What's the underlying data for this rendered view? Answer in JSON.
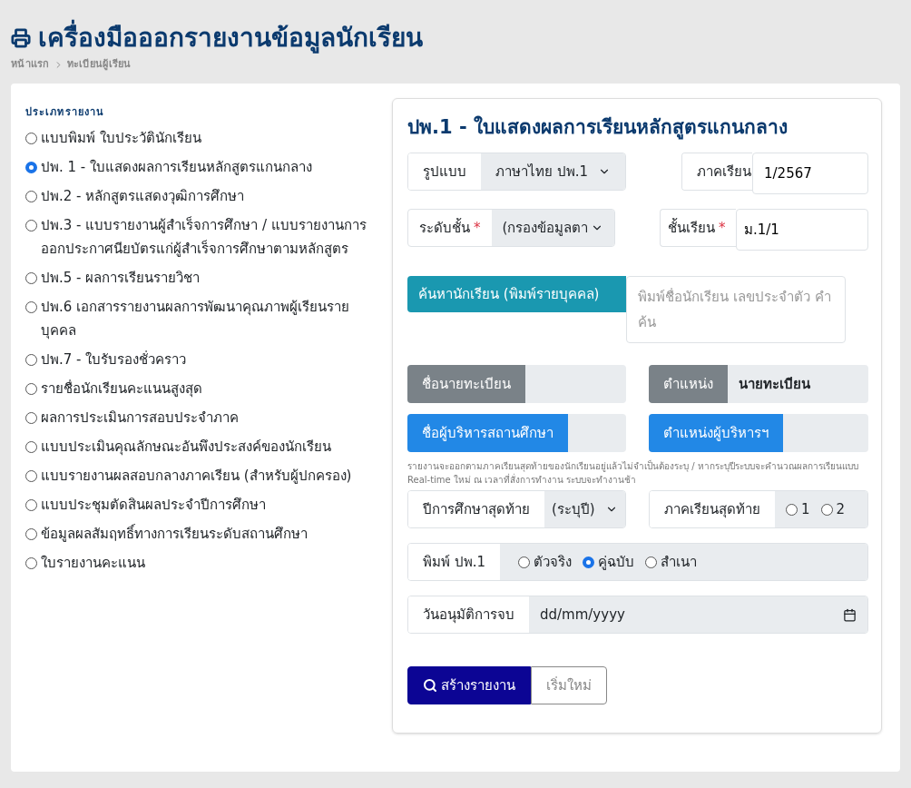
{
  "header": {
    "title": "เครื่องมือออกรายงานข้อมูลนักเรียน",
    "breadcrumb": [
      "หน้าแรก",
      "ทะเบียนผู้เรียน"
    ]
  },
  "report_types": {
    "label": "ประเภทรายงาน",
    "options": [
      {
        "label": "แบบพิมพ์ ใบประวัตินักเรียน",
        "selected": false
      },
      {
        "label": "ปพ. 1 - ใบแสดงผลการเรียนหลักสูตรแกนกลาง",
        "selected": true
      },
      {
        "label": "ปพ.2 - หลักสูตรแสดงวุฒิการศึกษา",
        "selected": false
      },
      {
        "label": "ปพ.3 - แบบรายงานผู้สำเร็จการศึกษา / แบบรายงานการออกประกาศนียบัตรแก่ผู้สำเร็จการศึกษาตามหลักสูตร",
        "selected": false
      },
      {
        "label": "ปพ.5 - ผลการเรียนรายวิชา",
        "selected": false
      },
      {
        "label": "ปพ.6 เอกสารรายงานผลการพัฒนาคุณภาพผู้เรียนรายบุคคล",
        "selected": false
      },
      {
        "label": "ปพ.7 - ใบรับรองชั่วคราว",
        "selected": false
      },
      {
        "label": "รายชื่อนักเรียนคะแนนสูงสุด",
        "selected": false
      },
      {
        "label": "ผลการประเมินการสอบประจำภาค",
        "selected": false
      },
      {
        "label": "แบบประเมินคุณลักษณะอันพึงประสงค์ของนักเรียน",
        "selected": false
      },
      {
        "label": "แบบรายงานผลสอบกลางภาคเรียน (สำหรับผู้ปกครอง)",
        "selected": false
      },
      {
        "label": "แบบประชุมตัดสินผลประจำปีการศึกษา",
        "selected": false
      },
      {
        "label": "ข้อมูลผลสัมฤทธิ์ทางการเรียนระดับสถานศึกษา",
        "selected": false
      },
      {
        "label": "ใบรายงานคะแนน",
        "selected": false
      }
    ]
  },
  "form": {
    "title": "ปพ.1 - ใบแสดงผลการเรียนหลักสูตรแกนกลาง",
    "format": {
      "label": "รูปแบบ",
      "value": "ภาษาไทย ปพ.1"
    },
    "semester": {
      "label": "ภาคเรียน",
      "value": "1/2567"
    },
    "level": {
      "label": "ระดับชั้น",
      "required_mark": "*",
      "value": "(กรองข้อมูลตา"
    },
    "classroom": {
      "label": "ชั้นเรียน",
      "required_mark": "*",
      "value": "ม.1/1"
    },
    "search": {
      "button": "ค้นหานักเรียน (พิมพ์รายบุคคล)",
      "placeholder": "พิมพ์ชื่อนักเรียน เลขประจำตัว คำค้น"
    },
    "registrar_name": {
      "label": "ชื่อนายทะเบียน"
    },
    "registrar_position": {
      "label": "ตำแหน่ง",
      "value": "นายทะเบียน"
    },
    "director_name": {
      "label": "ชื่อผู้บริหารสถานศึกษา"
    },
    "director_position": {
      "label": "ตำแหน่งผู้บริหารฯ"
    },
    "note": "รายงานจะออกตามภาคเรียนสุดท้ายของนักเรียนอยู่แล้วไม่จำเป็นต้องระบุ / หากระบุปีระบบจะคำนวณผลการเรียนแบบ Real-time ใหม่ ณ เวลาที่สั่งการทำงาน ระบบจะทำงานช้า",
    "last_year": {
      "label": "ปีการศึกษาสุดท้าย",
      "value": "(ระบุปี)"
    },
    "last_semester": {
      "label": "ภาคเรียนสุดท้าย",
      "options": [
        {
          "label": "1",
          "selected": false
        },
        {
          "label": "2",
          "selected": false
        }
      ]
    },
    "print_type": {
      "label": "พิมพ์ ปพ.1",
      "options": [
        {
          "label": "ตัวจริง",
          "selected": false
        },
        {
          "label": "คู่ฉบับ",
          "selected": true
        },
        {
          "label": "สำเนา",
          "selected": false
        }
      ]
    },
    "approval_date": {
      "label": "วันอนุมัติการจบ",
      "placeholder": "dd/mm/yyyy"
    },
    "buttons": [
      {
        "label": "สร้างรายงาน",
        "kind": "primary"
      },
      {
        "label": "เริ่มใหม่",
        "kind": "secondary"
      }
    ]
  }
}
